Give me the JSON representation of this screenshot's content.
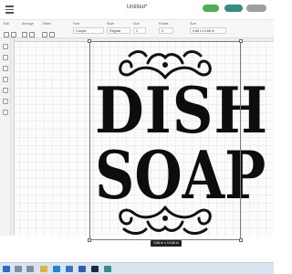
{
  "window": {
    "title": "Untitled*"
  },
  "toolbar": {
    "groups": [
      {
        "label": "Edit"
      },
      {
        "label": "Arrange"
      },
      {
        "label": "Offset"
      },
      {
        "label": "Font",
        "value": "Cooper"
      },
      {
        "label": "Style",
        "value": "Regular"
      },
      {
        "label": "Size",
        "value": "2"
      },
      {
        "label": "Rotate",
        "value": "0"
      },
      {
        "label": "Size",
        "value": "9.88 x 13.66 in"
      }
    ]
  },
  "design": {
    "line1": "DISH",
    "line2": "SOAP",
    "size_readout": "9.88 in x 13.66 in"
  },
  "colors": {
    "accent_green": "#4caf50",
    "accent_teal": "#2f8f84",
    "taskbar": "#d9e4f1"
  },
  "taskbar": {
    "icons": [
      "start-icon",
      "search-icon",
      "task-view-icon",
      "explorer-icon",
      "edge-icon",
      "store-icon",
      "mail-icon",
      "photoshop-icon",
      "design-app-icon"
    ]
  }
}
